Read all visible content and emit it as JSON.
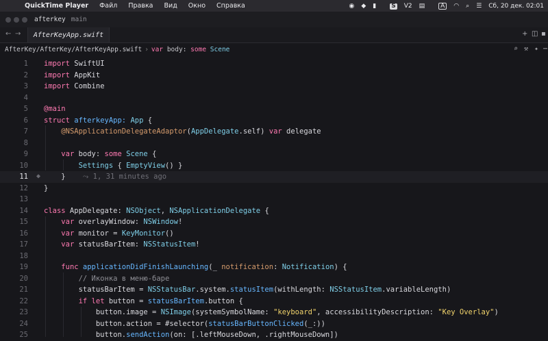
{
  "menubar": {
    "app_name": "QuickTime Player",
    "items": [
      "Файл",
      "Правка",
      "Вид",
      "Окно",
      "Справка"
    ],
    "status": {
      "vpn": "V2",
      "datetime": "Сб, 20 дек.  02:01"
    }
  },
  "window": {
    "project": "afterkey",
    "branch": "main"
  },
  "tab": {
    "label": "AfterKeyApp.swift"
  },
  "breadcrumb": {
    "path": "AfterKey/AfterKey/AfterKeyApp.swift",
    "symbol_kw": "var",
    "symbol_name": "body:",
    "symbol_some": "some",
    "symbol_type": "Scene"
  },
  "editor": {
    "active_line": 11,
    "blame": "1, 31 minutes ago",
    "lines": [
      {
        "n": "1"
      },
      {
        "n": "2"
      },
      {
        "n": "3"
      },
      {
        "n": "4"
      },
      {
        "n": "5"
      },
      {
        "n": "6"
      },
      {
        "n": "7"
      },
      {
        "n": "8"
      },
      {
        "n": "9"
      },
      {
        "n": "10"
      },
      {
        "n": "11"
      },
      {
        "n": "12"
      },
      {
        "n": "13"
      },
      {
        "n": "14"
      },
      {
        "n": "15"
      },
      {
        "n": "16"
      },
      {
        "n": "17"
      },
      {
        "n": "18"
      },
      {
        "n": "19"
      },
      {
        "n": "20"
      },
      {
        "n": "21"
      },
      {
        "n": "22"
      },
      {
        "n": "23"
      },
      {
        "n": "24"
      },
      {
        "n": "25"
      }
    ],
    "t": {
      "import": "import",
      "swiftui": "SwiftUI",
      "appkit": "AppKit",
      "combine": "Combine",
      "main": "@main",
      "struct": "struct",
      "app_name": "afterkeyApp:",
      "app": "App",
      "lbrace": " {",
      "at_adaptor": "@NSApplicationDelegateAdaptor",
      "lp": "(",
      "appdelegate": "AppDelegate",
      "self_rp": ".self) ",
      "var": "var",
      "delegate": " delegate",
      "body": " body: ",
      "some": "some",
      "scene": " Scene",
      "scene_brace": " {",
      "settings": "Settings",
      "ob": " { ",
      "emptyview": "EmptyView",
      "ev_tail": "() }",
      "rbrace": "}",
      "class": "class",
      "appdelegate_decl": " AppDelegate: ",
      "nsobject": "NSObject",
      "comma": ", ",
      "nsappdel": "NSApplicationDelegate",
      "brace_tail": " {",
      "overlay": " overlayWindow: ",
      "nswindow": "NSWindow",
      "bang": "!",
      "monitor": " monitor = ",
      "keymonitor": "KeyMonitor",
      "parens": "()",
      "statusbar": " statusBarItem: ",
      "nsstatusitem": "NSStatusItem",
      "func": "func",
      "adfl": " applicationDidFinishLaunching",
      "lp_us": "(_ ",
      "notif": "notification",
      "colon": ": ",
      "notification_t": "Notification",
      "rp_brace": ") {",
      "comment": "// Иконка в меню-баре",
      "sbi_assign": "statusBarItem = ",
      "nsstatusbar": "NSStatusBar",
      "system": ".system.",
      "statusitem": "statusItem",
      "wl": "(withLength: ",
      "nsstatusitem2": "NSStatusItem",
      "varlen": ".variableLength)",
      "if": "if",
      "let": " let",
      "button_eq": " button = ",
      "sbi": "statusBarItem",
      "dot_button": ".button {",
      "button_image": "button.image = ",
      "nsimage": "NSImage",
      "ssn": "(systemSymbolName: ",
      "keyboard": "\"keyboard\"",
      "acc": ", accessibilityDescription: ",
      "keyov": "\"Key Overlay\"",
      "rp": ")",
      "button_action": "button.action = #selector(",
      "sbbc": "statusBarButtonClicked",
      "sel_tail": "(_:))",
      "button_dot": "button.",
      "sendaction": "sendAction",
      "on_args": "(on: [.leftMouseDown, .rightMouseDown])"
    }
  }
}
